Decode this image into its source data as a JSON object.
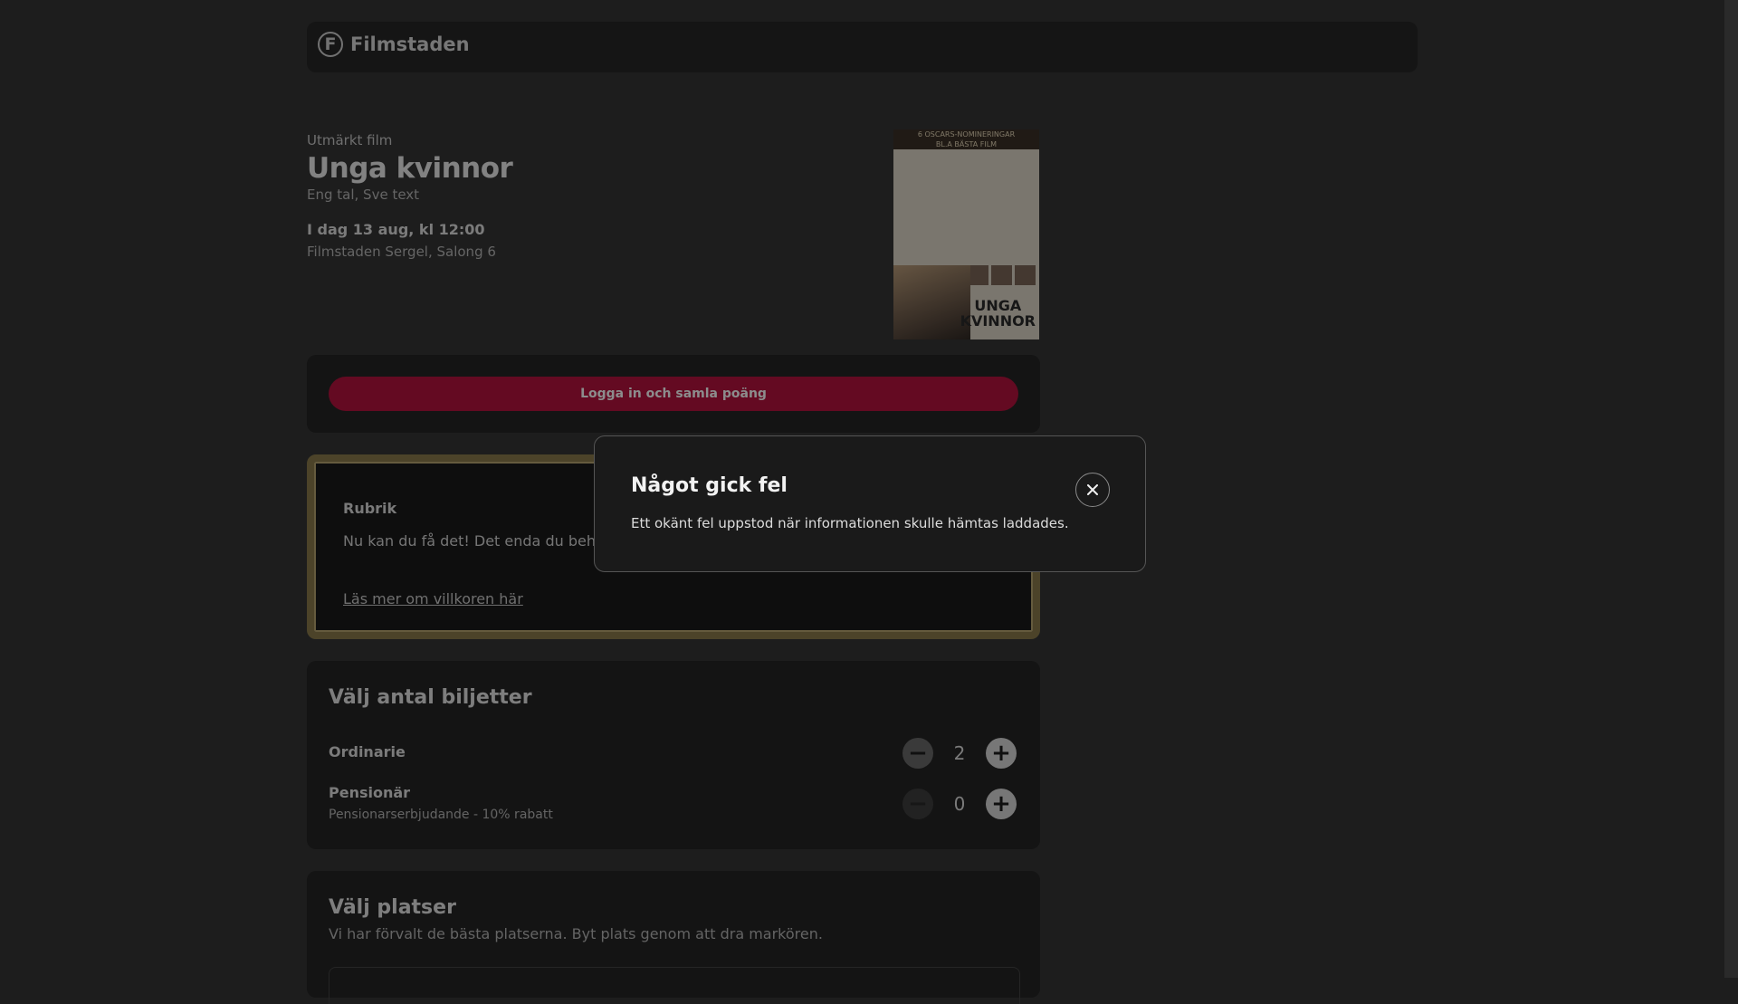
{
  "app": {
    "name": "Filmstaden",
    "logo_letter": "F"
  },
  "film": {
    "label": "Utmärkt film",
    "title": "Unga kvinnor",
    "language": "Eng tal, Sve text",
    "datetime": "I dag 13 aug, kl 12:00",
    "location": "Filmstaden Sergel, Salong 6",
    "poster": {
      "top_text": "6 OSCARS-NOMINERINGAR\nBL.A BÄSTA FILM",
      "title": "UNGA\nKVINNOR"
    }
  },
  "login": {
    "button_label": "Logga in och samla poäng"
  },
  "promo": {
    "heading": "Rubrik",
    "text": "Nu kan du få det! Det enda du beh bla och du har chans att vinna!",
    "link": "Läs mer om villkoren här"
  },
  "tickets": {
    "heading": "Välj antal biljetter",
    "rows": [
      {
        "label": "Ordinarie",
        "sub": "",
        "count": "2"
      },
      {
        "label": "Pensionär",
        "sub": "Pensionarserbjudande - 10% rabatt",
        "count": "0"
      }
    ]
  },
  "seats": {
    "heading": "Välj platser",
    "subtitle": "Vi har förvalt de bästa platserna. Byt plats genom att dra markören."
  },
  "modal": {
    "title": "Något gick fel",
    "message": "Ett okänt fel uppstod när informationen skulle hämtas laddades."
  },
  "colors": {
    "background": "#1d1d1d",
    "card": "#252525",
    "accent": "#b5123d",
    "modal_bg": "#1a1a1a"
  }
}
